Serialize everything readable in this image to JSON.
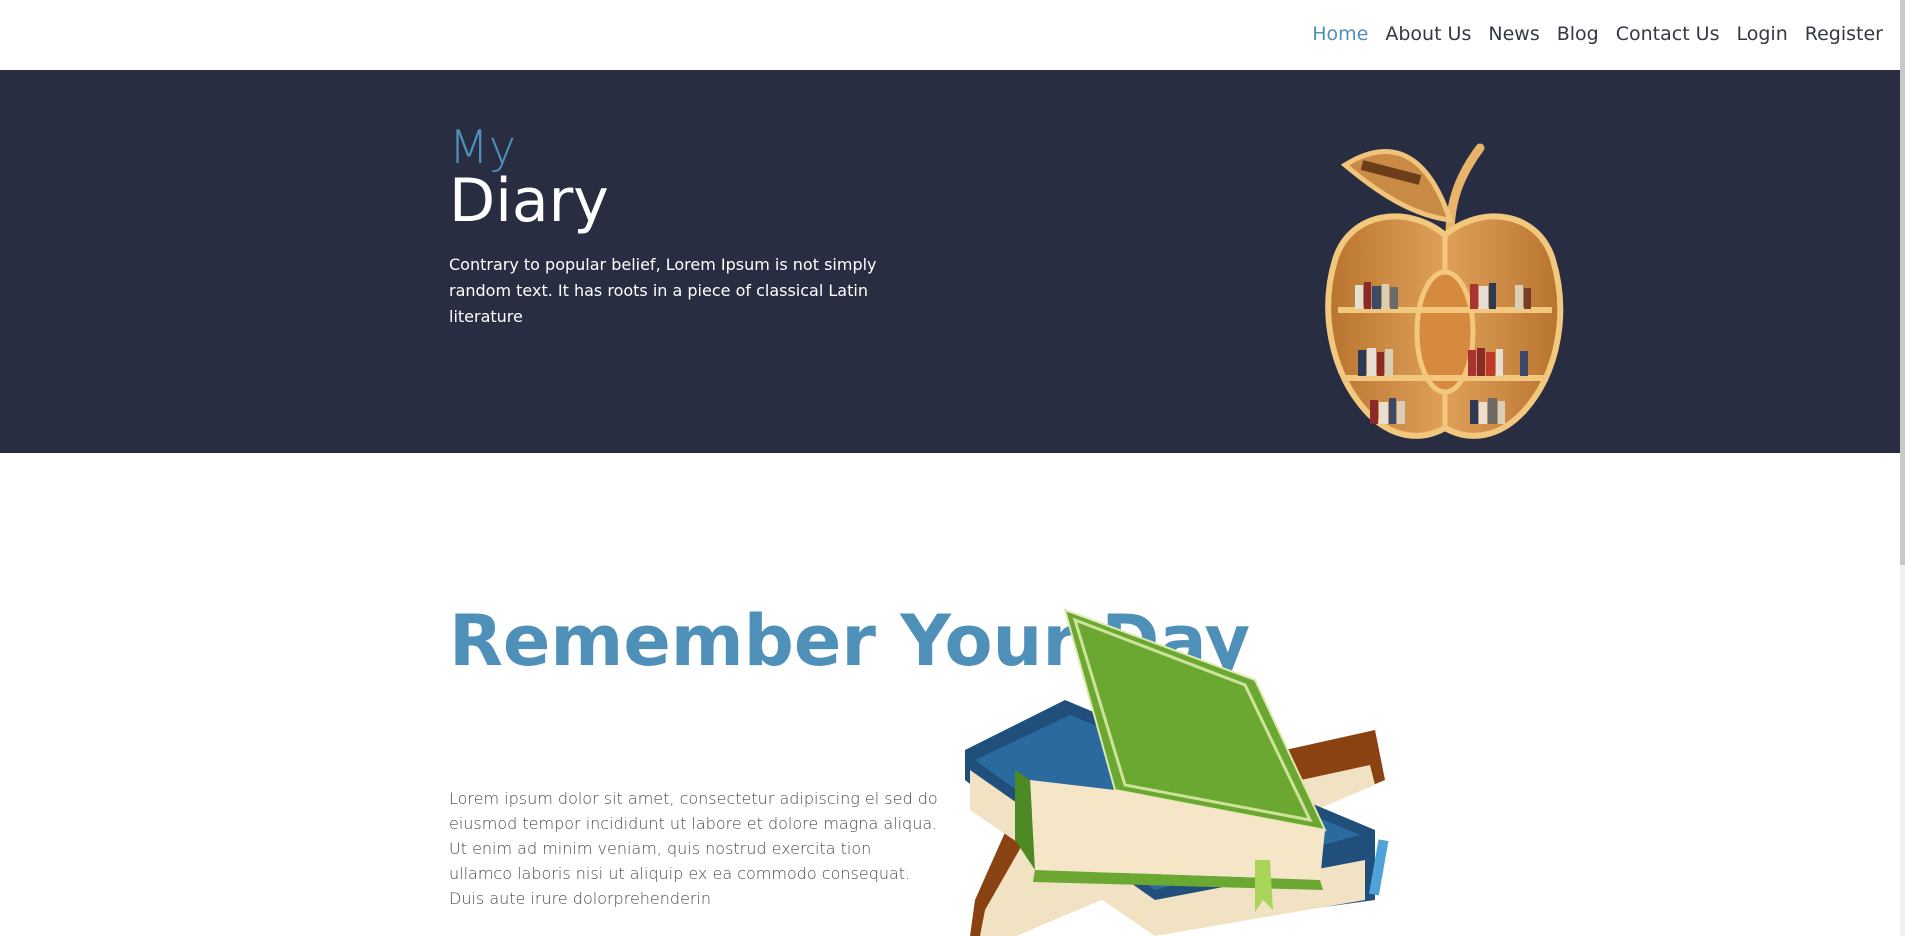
{
  "nav": {
    "items": [
      {
        "label": "Home",
        "active": true
      },
      {
        "label": "About Us"
      },
      {
        "label": "News"
      },
      {
        "label": "Blog"
      },
      {
        "label": "Contact Us"
      },
      {
        "label": "Login"
      },
      {
        "label": "Register"
      }
    ]
  },
  "hero": {
    "title_small": "My",
    "title_big": "Diary",
    "text": "Contrary to popular belief, Lorem Ipsum is not simply random text. It has roots in a piece of classical Latin literature",
    "image_icon": "apple-bookshelf-icon"
  },
  "section": {
    "title": "Remember Your Day",
    "text": "Lorem ipsum dolor sit amet, consectetur adipiscing el sed do eiusmod tempor incididunt ut labore et dolore magna aliqua. Ut enim ad minim veniam, quis nostrud exercita tion ullamco laboris nisi ut aliquip ex ea commodo consequat. Duis aute irure dolorprehenderin",
    "image_icon": "book-stack-icon"
  },
  "colors": {
    "accent": "#4f90b8",
    "hero_bg": "#282d42",
    "nav_text": "#333842"
  }
}
